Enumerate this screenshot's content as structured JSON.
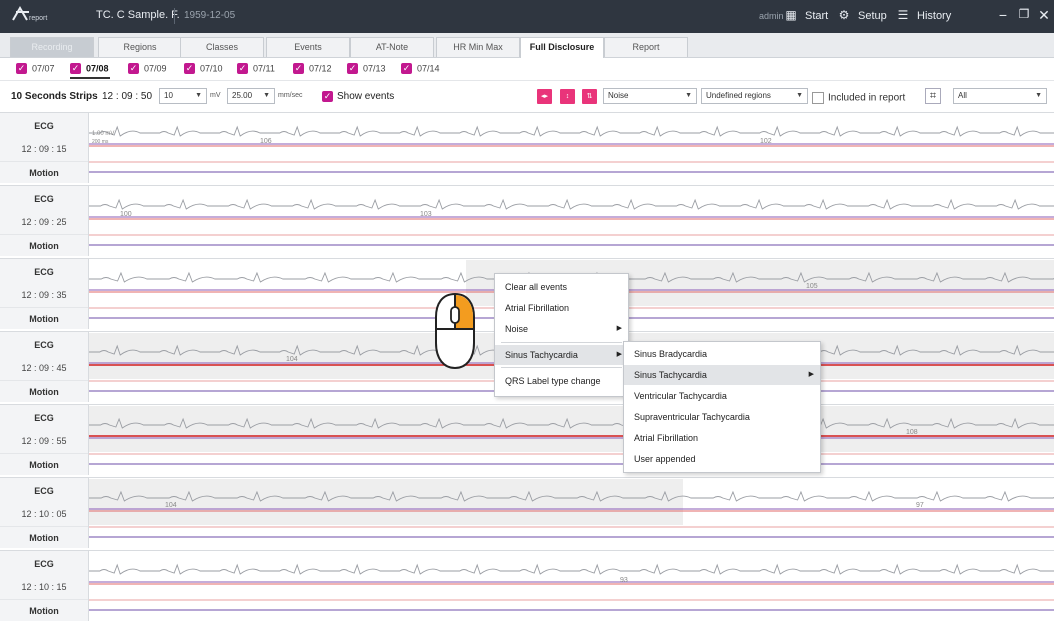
{
  "titlebar": {
    "logo_text": "report",
    "patient": "TC. C Sample. F.",
    "date": "1959-12-05",
    "user": "admin",
    "buttons": [
      {
        "label": "Start",
        "icon": "grid-icon"
      },
      {
        "label": "Setup",
        "icon": "gear-icon"
      },
      {
        "label": "History",
        "icon": "history-icon"
      }
    ]
  },
  "tabs": [
    "Recording",
    "Regions",
    "Classes",
    "Events",
    "AT-Note",
    "HR Min Max",
    "Full Disclosure",
    "Report"
  ],
  "active_tab": "Full Disclosure",
  "dates": [
    "07/07",
    "07/08",
    "07/09",
    "07/10",
    "07/11",
    "07/12",
    "07/13",
    "07/14"
  ],
  "active_date": "07/08",
  "toolbar": {
    "strips_label": "10 Seconds Strips",
    "time": "12 : 09 : 50",
    "gain": "10",
    "gain_unit": "mV",
    "speed": "25.00",
    "speed_unit": "mm/sec",
    "show_events_label": "Show events",
    "show_events": true,
    "noise_select": "Noise",
    "region_select": "Undefined regions",
    "included_label": "Included in report",
    "included": false,
    "filter_select": "All"
  },
  "scale_labels": {
    "mv": "1.00 mV",
    "ms": "200 ms"
  },
  "strips": [
    {
      "ecg": "ECG",
      "time": "12 : 09 : 15",
      "motion": "Motion",
      "hr": [
        "106",
        "102"
      ]
    },
    {
      "ecg": "ECG",
      "time": "12 : 09 : 25",
      "motion": "Motion",
      "hr": [
        "100",
        "103"
      ]
    },
    {
      "ecg": "ECG",
      "time": "12 : 09 : 35",
      "motion": "Motion",
      "hr": [
        "105"
      ]
    },
    {
      "ecg": "ECG",
      "time": "12 : 09 : 45",
      "motion": "Motion",
      "hr": [
        "104"
      ]
    },
    {
      "ecg": "ECG",
      "time": "12 : 09 : 55",
      "motion": "Motion",
      "hr": [
        "108"
      ]
    },
    {
      "ecg": "ECG",
      "time": "12 : 10 : 05",
      "motion": "Motion",
      "hr": [
        "104",
        "97"
      ]
    },
    {
      "ecg": "ECG",
      "time": "12 : 10 : 15",
      "motion": "Motion",
      "hr": [
        "93"
      ]
    }
  ],
  "context_menu": {
    "items": [
      "Clear all events",
      "Atrial Fibrillation",
      "Noise",
      "Sinus Tachycardia",
      "QRS Label type change"
    ],
    "submenu_items": [
      "Sinus Bradycardia",
      "Sinus Tachycardia",
      "Ventricular Tachycardia",
      "Supraventricular Tachycardia",
      "Atrial Fibrillation",
      "User appended"
    ]
  },
  "colors": {
    "accent": "#c2188f",
    "event_button": "#e9347a",
    "titlebar": "#2f3640",
    "mouse_button": "#f39c1f"
  }
}
